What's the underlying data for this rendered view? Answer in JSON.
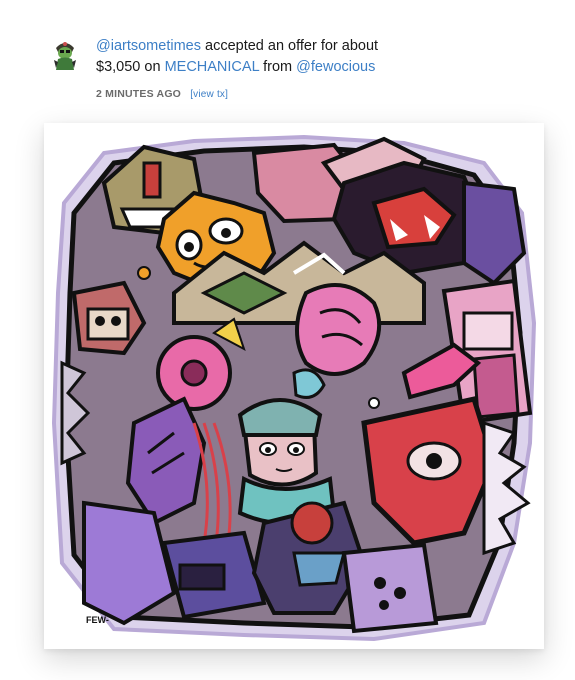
{
  "activity": {
    "actor_handle": "@iartsometimes",
    "action_text": "accepted an offer for about",
    "price": "$3,050",
    "on_text": "on",
    "artwork_title": "MECHANICAL",
    "from_text": "from",
    "buyer_handle": "@fewocious",
    "time_ago": "2 MINUTES AGO",
    "view_tx_label": "[view tx]"
  },
  "artwork": {
    "signature_text": "FEW-"
  },
  "colors": {
    "link": "#3d7fc6",
    "meta_gray": "#6b6b6b",
    "text": "#1a1a1a"
  }
}
